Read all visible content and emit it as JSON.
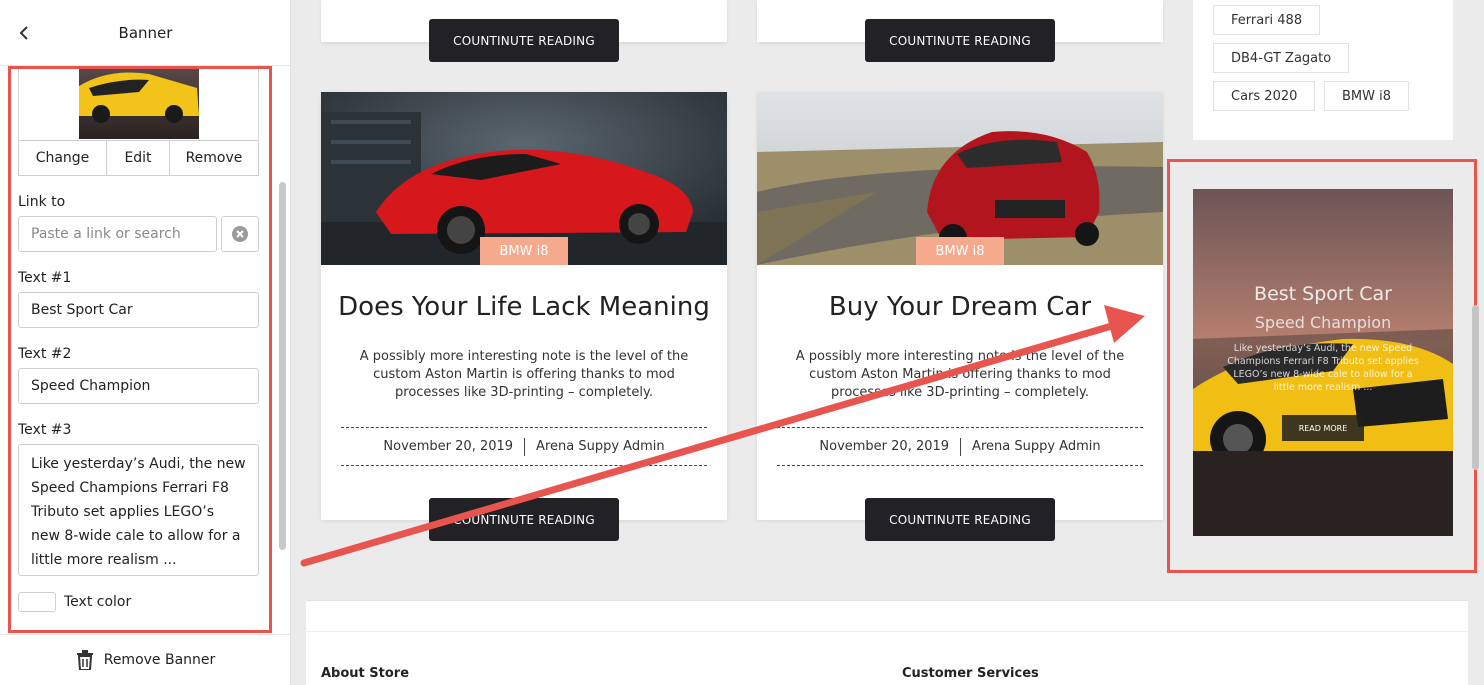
{
  "panel": {
    "title": "Banner",
    "image_actions": {
      "change": "Change",
      "edit": "Edit",
      "remove": "Remove"
    },
    "link": {
      "label": "Link to",
      "placeholder": "Paste a link or search"
    },
    "text1": {
      "label": "Text #1",
      "value": "Best Sport Car"
    },
    "text2": {
      "label": "Text #2",
      "value": "Speed Champion"
    },
    "text3": {
      "label": "Text #3",
      "value": "Like yesterday’s Audi, the new Speed Champions Ferrari F8 Tributo set applies LEGO’s new 8-wide cale to allow for a little more realism ..."
    },
    "text_color": {
      "label": "Text color",
      "value": "#ffffff"
    },
    "remove_banner": "Remove Banner"
  },
  "preview": {
    "continue_label": "COUNTINUTE READING",
    "posts": [
      {
        "tag": "BMW i8",
        "title": "Does Your Life Lack Meaning",
        "excerpt": "A possibly more interesting note is the level of the custom Aston Martin is offering thanks to mod processes like 3D-printing – completely.",
        "date": "November 20, 2019",
        "author": "Arena Suppy Admin"
      },
      {
        "tag": "BMW i8",
        "title": "Buy Your Dream Car",
        "excerpt": "A possibly more interesting note is the level of the custom Aston Martin is offering thanks to mod processes like 3D-printing – completely.",
        "date": "November 20, 2019",
        "author": "Arena Suppy Admin"
      }
    ],
    "tags": [
      "Ferrari 488",
      "DB4-GT Zagato",
      "Cars 2020",
      "BMW i8"
    ],
    "banner": {
      "text1": "Best Sport Car",
      "text2": "Speed Champion",
      "text3": "Like yesterday’s Audi, the new Speed Champions Ferrari F8 Tributo set applies LEGO’s new 8-wide cale to allow for a little more realism ...",
      "button": "READ MORE"
    },
    "footer": {
      "col1": "About Store",
      "col2": "Customer Services"
    }
  },
  "colors": {
    "highlight": "#e8544e",
    "tag_bg": "#f5a98d",
    "button_bg": "#212126"
  }
}
